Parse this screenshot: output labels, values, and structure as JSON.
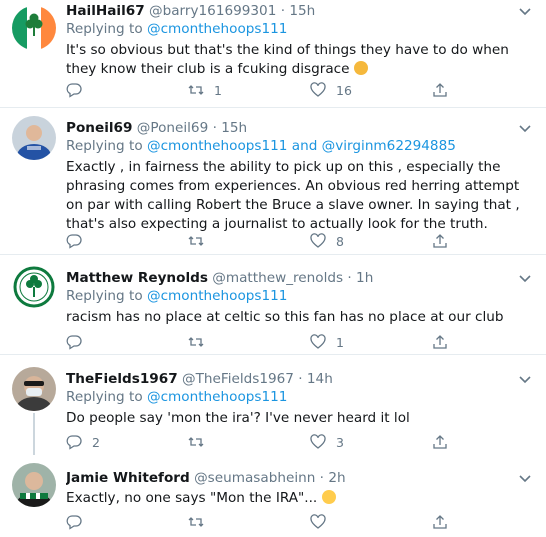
{
  "tweets": [
    {
      "name": "HailHail67",
      "handle": "@barry161699301",
      "dot": "·",
      "time": "15h",
      "reply_prefix": "Replying to",
      "reply_mentions": "@cmonthehoops111",
      "text": "It's so obvious but that's the kind of things they have to do when they know their club is a fcuking disgrace",
      "emoji": "face-with-steam-emoji",
      "replies": "",
      "retweets": "1",
      "likes": "16"
    },
    {
      "name": "Poneil69",
      "handle": "@Poneil69",
      "dot": "·",
      "time": "15h",
      "reply_prefix": "Replying to",
      "reply_mentions": "@cmonthehoops111 and @virginm62294885",
      "text": "Exactly , in fairness the ability to pick up on this , especially the phrasing comes from experiences. An obvious red herring attempt on par with calling Robert the Bruce a slave owner. In saying that , that's also expecting a journalist to actually look for the truth.",
      "replies": "",
      "retweets": "",
      "likes": "8"
    },
    {
      "name": "Matthew Reynolds",
      "handle": "@matthew_renolds",
      "dot": "·",
      "time": "1h",
      "reply_prefix": "Replying to",
      "reply_mentions": "@cmonthehoops111",
      "text": "racism has no place at celtic so this fan has no place at our club",
      "replies": "",
      "retweets": "",
      "likes": "1"
    },
    {
      "name": "TheFields1967",
      "handle": "@TheFields1967",
      "dot": "·",
      "time": "14h",
      "reply_prefix": "Replying to",
      "reply_mentions": "@cmonthehoops111",
      "text": "Do people say 'mon the ira'? I've never heard it lol",
      "replies": "2",
      "retweets": "",
      "likes": "3"
    },
    {
      "name": "Jamie Whiteford",
      "handle": "@seumasabheinn",
      "dot": "·",
      "time": "2h",
      "text": "Exactly, no one says \"Mon the IRA\"...",
      "emoji": "grinning-sweat-emoji",
      "replies": "",
      "retweets": "",
      "likes": ""
    }
  ],
  "colors": {
    "accent": "#1b95e0",
    "secondary_text": "#657786",
    "primary_text": "#14171a",
    "divider": "#e6ecf0"
  }
}
